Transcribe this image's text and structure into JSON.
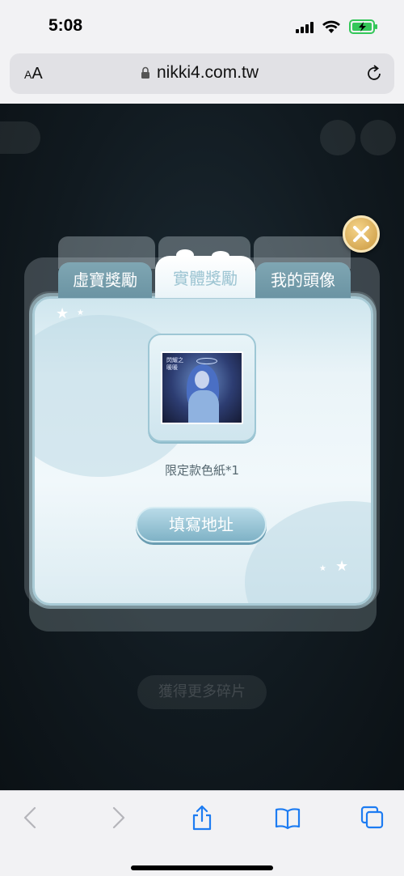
{
  "status_bar": {
    "time": "5:08"
  },
  "browser": {
    "aa_big": "A",
    "aa_small": "A",
    "url": "nikki4.com.tw"
  },
  "modal": {
    "tabs": [
      {
        "label": "虛寶獎勵",
        "active": false
      },
      {
        "label": "實體獎勵",
        "active": true
      },
      {
        "label": "我的頭像",
        "active": false
      }
    ],
    "prize_label": "限定款色紙*1",
    "address_button": "填寫地址",
    "artwork_caption": "閃耀之 暖暖"
  },
  "background": {
    "bottom_button": "獲得更多碎片",
    "ghost_tabs": [
      "虛寶獎勵",
      "實體獎勵",
      "我的頭像"
    ]
  },
  "colors": {
    "tab_inactive": "#6b94a3",
    "tab_active_text": "#9cc4d2",
    "button_gradient_bottom": "#7fb2c6",
    "close_button": "#c9973e",
    "game_background": "#111a20"
  },
  "icons": {
    "toolbar": [
      "back-icon",
      "forward-icon",
      "share-icon",
      "bookmarks-icon",
      "tabs-icon"
    ]
  }
}
